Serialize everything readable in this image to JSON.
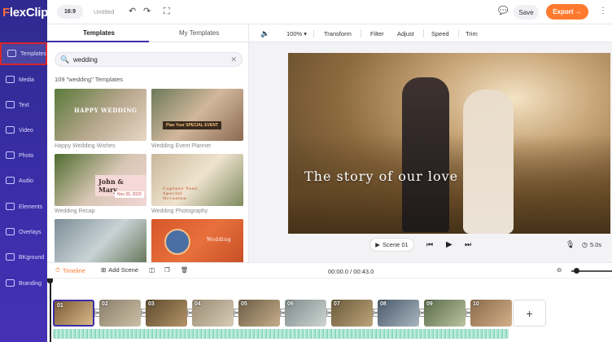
{
  "app": {
    "logo_main": "lexClip",
    "logo_initial": "F"
  },
  "sidebar": {
    "items": [
      {
        "label": "Templates",
        "icon": "layers-icon"
      },
      {
        "label": "Media",
        "icon": "media-icon"
      },
      {
        "label": "Text",
        "icon": "text-icon"
      },
      {
        "label": "Video",
        "icon": "video-icon"
      },
      {
        "label": "Photo",
        "icon": "photo-icon"
      },
      {
        "label": "Audio",
        "icon": "audio-icon"
      },
      {
        "label": "Elements",
        "icon": "elements-icon"
      },
      {
        "label": "Overlays",
        "icon": "overlays-icon"
      },
      {
        "label": "BKground",
        "icon": "background-icon"
      },
      {
        "label": "Branding",
        "icon": "branding-icon"
      }
    ],
    "active": "Templates"
  },
  "topbar": {
    "ratio": "16:9",
    "doc_title": "Untitled",
    "save": "Save",
    "export": "Export →"
  },
  "panel": {
    "tabs": [
      "Templates",
      "My Templates"
    ],
    "search_value": "wedding",
    "count_text": "109 \"wedding\" Templates",
    "templates": [
      {
        "caption": "Happy Wedding Wishes",
        "overlay": "HAPPY WEDDING"
      },
      {
        "caption": "Wedding Event Planner",
        "overlay": "Plan Your SPECIAL EVENT"
      },
      {
        "caption": "Wedding Recap",
        "overlay": "John & Mary",
        "overlay_sub": "Nov 20, 2020"
      },
      {
        "caption": "Wedding Photography",
        "overlay": "Capture Your Special Occasion"
      },
      {
        "caption": "",
        "overlay": ""
      },
      {
        "caption": "",
        "overlay": "Wedding"
      }
    ]
  },
  "editor": {
    "zoom": "100%",
    "tools": [
      "Transform",
      "Filter",
      "Adjust",
      "Speed",
      "Trim"
    ],
    "preview_caption": "The story of our love",
    "scene_label": "Scene 01",
    "duration": "5.0s"
  },
  "timeline": {
    "tab_timeline": "Timeline",
    "add_scene": "Add Scene",
    "time": "00:00.0 / 00:43.0",
    "clips": [
      "01",
      "02",
      "03",
      "04",
      "05",
      "06",
      "07",
      "08",
      "09",
      "10"
    ]
  },
  "colors": {
    "brand": "#3a2ea8",
    "accent": "#ff7a2f",
    "selection": "#d7262b"
  }
}
